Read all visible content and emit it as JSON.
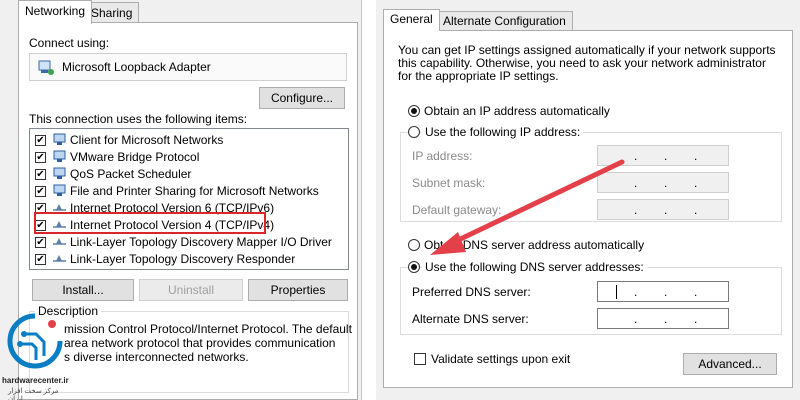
{
  "left_dialog": {
    "tabs": [
      "Networking",
      "Sharing"
    ],
    "connect_using_label": "Connect using:",
    "adapter_name": "Microsoft Loopback Adapter",
    "configure_button": "Configure...",
    "items_label": "This connection uses the following items:",
    "items": [
      {
        "label": "Client for Microsoft Networks",
        "checked": true,
        "icon": "network-client-icon"
      },
      {
        "label": "VMware Bridge Protocol",
        "checked": true,
        "icon": "network-protocol-icon"
      },
      {
        "label": "QoS Packet Scheduler",
        "checked": true,
        "icon": "network-protocol-icon"
      },
      {
        "label": "File and Printer Sharing for Microsoft Networks",
        "checked": true,
        "icon": "network-service-icon"
      },
      {
        "label": "Internet Protocol Version 6 (TCP/IPv6)",
        "checked": true,
        "icon": "protocol-icon"
      },
      {
        "label": "Internet Protocol Version 4 (TCP/IPv4)",
        "checked": true,
        "icon": "protocol-icon",
        "highlighted": true
      },
      {
        "label": "Link-Layer Topology Discovery Mapper I/O Driver",
        "checked": true,
        "icon": "protocol-icon"
      },
      {
        "label": "Link-Layer Topology Discovery Responder",
        "checked": true,
        "icon": "protocol-icon"
      }
    ],
    "install_button": "Install...",
    "uninstall_button": "Uninstall",
    "properties_button": "Properties",
    "description_label": "Description",
    "description_lines": [
      "mission Control Protocol/Internet Protocol. The default",
      "area network protocol that provides communication",
      "s diverse interconnected networks."
    ]
  },
  "right_dialog": {
    "tabs": [
      "General",
      "Alternate Configuration"
    ],
    "intro_lines": [
      "You can get IP settings assigned automatically if your network supports",
      "this capability. Otherwise, you need to ask your network administrator",
      "for the appropriate IP settings."
    ],
    "obtain_ip_auto": "Obtain an IP address automatically",
    "use_following_ip": "Use the following IP address:",
    "ip_address_label": "IP address:",
    "subnet_mask_label": "Subnet mask:",
    "default_gateway_label": "Default gateway:",
    "obtain_dns_auto": "Obtain DNS server address automatically",
    "use_following_dns": "Use the following DNS server addresses:",
    "preferred_dns_label": "Preferred DNS server:",
    "alternate_dns_label": "Alternate DNS server:",
    "validate_label": "Validate settings upon exit",
    "validate_checked": false,
    "advanced_button": "Advanced...",
    "ip_placeholder_dots": "."
  },
  "watermark": {
    "brand": "hardwarecenter.ir",
    "subtitle": "مرکز سخت افزار ایران"
  },
  "colors": {
    "highlight_box": "#d9262c",
    "arrow": "#e3404a"
  }
}
